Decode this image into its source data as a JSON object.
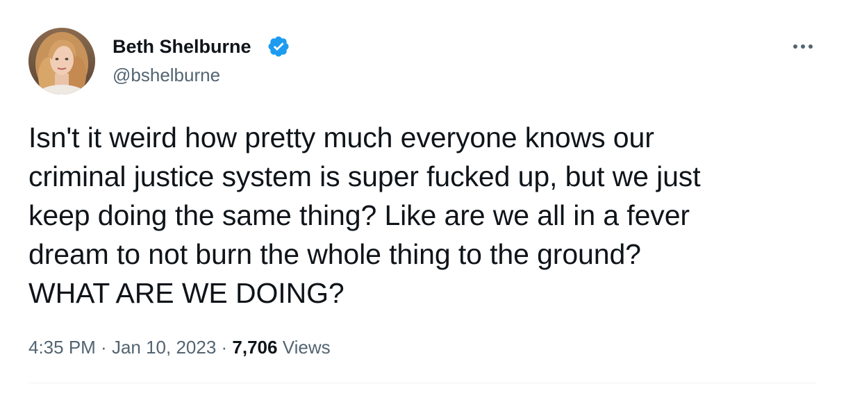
{
  "author": {
    "name": "Beth Shelburne",
    "handle": "@bshelburne",
    "verified": true
  },
  "tweet": {
    "lines": [
      "Isn't it weird how pretty much everyone knows our",
      "criminal justice system is super fucked up, but we just",
      "keep doing the same thing? Like are we all in a fever",
      "dream to not burn the whole thing to the ground?",
      "WHAT ARE WE DOING?"
    ]
  },
  "meta": {
    "time": "4:35 PM",
    "separator": " · ",
    "date": "Jan 10, 2023",
    "views_count": "7,706",
    "views_label": "Views"
  },
  "icons": {
    "verified": "verified-badge-icon",
    "more": "more-options-icon"
  },
  "colors": {
    "text_primary": "#0f1419",
    "text_secondary": "#536471",
    "verified_blue": "#1d9bf0",
    "divider": "#eff3f4"
  }
}
